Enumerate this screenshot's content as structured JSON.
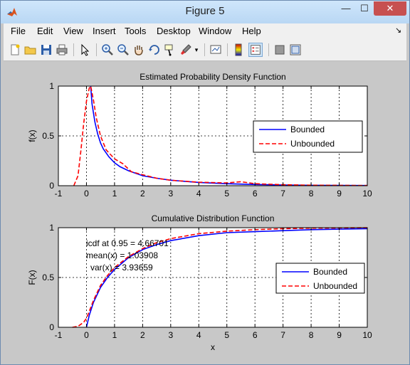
{
  "window": {
    "title": "Figure 5",
    "min": "—",
    "max": "☐",
    "close": "✕"
  },
  "menu": {
    "items": [
      "File",
      "Edit",
      "View",
      "Insert",
      "Tools",
      "Desktop",
      "Window",
      "Help"
    ],
    "dock": "↘"
  },
  "toolbar": {
    "icons": [
      "new-figure-icon",
      "open-file-icon",
      "save-icon",
      "print-icon",
      "arrow-pointer-icon",
      "zoom-in-icon",
      "zoom-out-icon",
      "pan-hand-icon",
      "rotate-3d-icon",
      "data-cursor-icon",
      "brush-icon",
      "dropdown-arrow-icon",
      "link-plot-icon",
      "colorbar-icon",
      "legend-icon",
      "hide-plot-tools-icon",
      "show-plot-tools-icon"
    ]
  },
  "chart_data": [
    {
      "type": "line",
      "title": "Estimated Probability Density Function",
      "xlabel": "",
      "ylabel": "f(x)",
      "xlim": [
        -1,
        10
      ],
      "ylim": [
        0,
        1
      ],
      "xticks": [
        "-1",
        "0",
        "1",
        "2",
        "3",
        "4",
        "5",
        "6",
        "7",
        "8",
        "9",
        "10"
      ],
      "yticks": [
        "0",
        "0.5",
        "1"
      ],
      "grid": true,
      "legend": "right",
      "series": [
        {
          "name": "Bounded",
          "color": "#0000ff",
          "style": "solid",
          "x": [
            0.15,
            0.2,
            0.3,
            0.4,
            0.5,
            0.6,
            0.8,
            1.0,
            1.2,
            1.5,
            2.0,
            2.5,
            3.0,
            4.0,
            5.0,
            6.0,
            7.0,
            8.0,
            10.0
          ],
          "y": [
            1.0,
            0.82,
            0.64,
            0.52,
            0.43,
            0.37,
            0.29,
            0.23,
            0.19,
            0.15,
            0.1,
            0.075,
            0.055,
            0.033,
            0.02,
            0.012,
            0.007,
            0.004,
            0.002
          ]
        },
        {
          "name": "Unbounded",
          "color": "#ff0000",
          "style": "dashed",
          "x": [
            -0.45,
            -0.3,
            -0.2,
            -0.1,
            0.0,
            0.1,
            0.15,
            0.25,
            0.35,
            0.5,
            0.7,
            1.0,
            1.3,
            1.6,
            2.0,
            2.5,
            3.0,
            4.0,
            5.0,
            5.5,
            6.0,
            7.0,
            8.0,
            10.0
          ],
          "y": [
            0.0,
            0.1,
            0.35,
            0.62,
            0.85,
            0.98,
            1.0,
            0.86,
            0.68,
            0.5,
            0.36,
            0.27,
            0.22,
            0.14,
            0.11,
            0.075,
            0.055,
            0.035,
            0.028,
            0.04,
            0.02,
            0.01,
            0.005,
            0.002
          ]
        }
      ]
    },
    {
      "type": "line",
      "title": "Cumulative Distribution Function",
      "xlabel": "x",
      "ylabel": "F(x)",
      "xlim": [
        -1,
        10
      ],
      "ylim": [
        0,
        1
      ],
      "xticks": [
        "-1",
        "0",
        "1",
        "2",
        "3",
        "4",
        "5",
        "6",
        "7",
        "8",
        "9",
        "10"
      ],
      "yticks": [
        "0",
        "0.5",
        "1"
      ],
      "grid": true,
      "legend": "right",
      "annotations": [
        "icdf at 0.95 = 4.66701",
        "mean(x) = 1.03908",
        "var(x) = 3.93659"
      ],
      "series": [
        {
          "name": "Bounded",
          "color": "#0000ff",
          "style": "solid",
          "x": [
            0.0,
            0.1,
            0.25,
            0.5,
            0.75,
            1.0,
            1.5,
            2.0,
            2.5,
            3.0,
            4.0,
            5.0,
            6.0,
            7.0,
            8.0,
            9.0,
            10.0
          ],
          "y": [
            0.0,
            0.12,
            0.25,
            0.4,
            0.5,
            0.58,
            0.7,
            0.78,
            0.83,
            0.87,
            0.92,
            0.95,
            0.96,
            0.97,
            0.98,
            0.985,
            0.99
          ]
        },
        {
          "name": "Unbounded",
          "color": "#ff0000",
          "style": "dashed",
          "x": [
            -0.5,
            -0.3,
            -0.1,
            0.0,
            0.1,
            0.25,
            0.5,
            0.75,
            1.0,
            1.5,
            2.0,
            2.5,
            3.0,
            4.0,
            5.0,
            6.0,
            7.0,
            8.0,
            10.0
          ],
          "y": [
            0.0,
            0.01,
            0.05,
            0.09,
            0.16,
            0.27,
            0.42,
            0.52,
            0.6,
            0.71,
            0.79,
            0.85,
            0.89,
            0.94,
            0.965,
            0.98,
            0.99,
            0.995,
            1.0
          ]
        }
      ]
    }
  ]
}
